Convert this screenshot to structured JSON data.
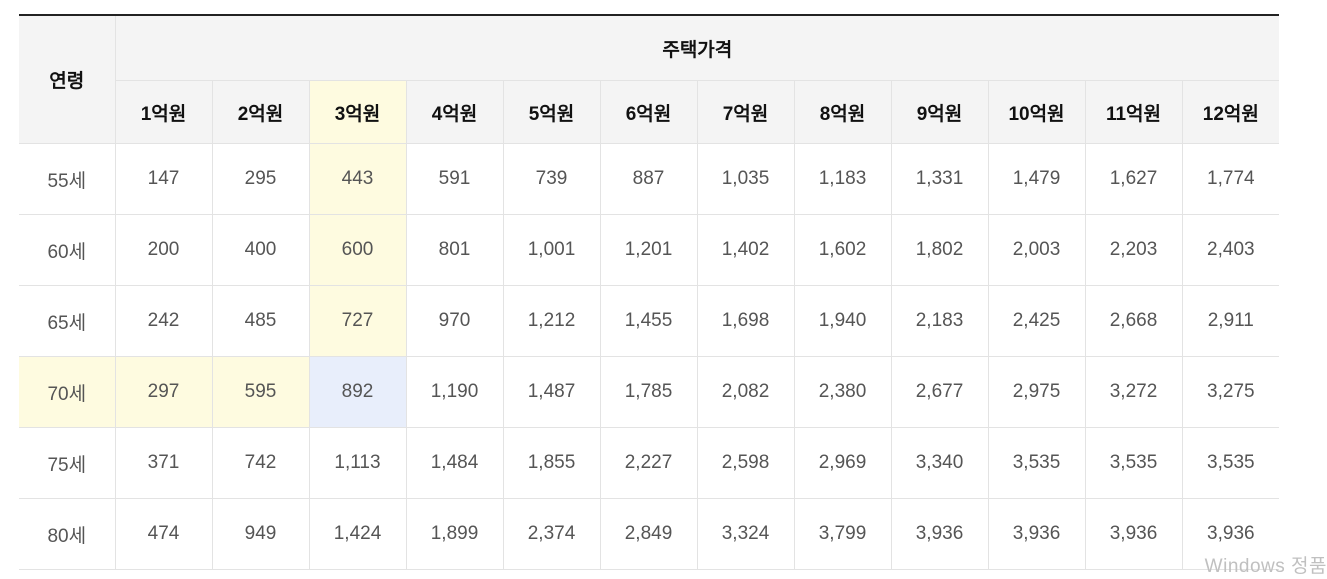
{
  "table": {
    "age_header": "연령",
    "price_header": "주택가격",
    "columns": [
      "1억원",
      "2억원",
      "3억원",
      "4억원",
      "5억원",
      "6억원",
      "7억원",
      "8억원",
      "9억원",
      "10억원",
      "11억원",
      "12억원"
    ],
    "rows": [
      {
        "age": "55세",
        "values": [
          "147",
          "295",
          "443",
          "591",
          "739",
          "887",
          "1,035",
          "1,183",
          "1,331",
          "1,479",
          "1,627",
          "1,774"
        ]
      },
      {
        "age": "60세",
        "values": [
          "200",
          "400",
          "600",
          "801",
          "1,001",
          "1,201",
          "1,402",
          "1,602",
          "1,802",
          "2,003",
          "2,203",
          "2,403"
        ]
      },
      {
        "age": "65세",
        "values": [
          "242",
          "485",
          "727",
          "970",
          "1,212",
          "1,455",
          "1,698",
          "1,940",
          "2,183",
          "2,425",
          "2,668",
          "2,911"
        ]
      },
      {
        "age": "70세",
        "values": [
          "297",
          "595",
          "892",
          "1,190",
          "1,487",
          "1,785",
          "2,082",
          "2,380",
          "2,677",
          "2,975",
          "3,272",
          "3,275"
        ]
      },
      {
        "age": "75세",
        "values": [
          "371",
          "742",
          "1,113",
          "1,484",
          "1,855",
          "2,227",
          "2,598",
          "2,969",
          "3,340",
          "3,535",
          "3,535",
          "3,535"
        ]
      },
      {
        "age": "80세",
        "values": [
          "474",
          "949",
          "1,424",
          "1,899",
          "2,374",
          "2,849",
          "3,324",
          "3,799",
          "3,936",
          "3,936",
          "3,936",
          "3,936"
        ]
      }
    ]
  },
  "highlight": {
    "column_index": 2,
    "row_index": 3,
    "yellow": "#fefbe0",
    "blue": "#e8eefb"
  },
  "watermark": "Windows 정품"
}
